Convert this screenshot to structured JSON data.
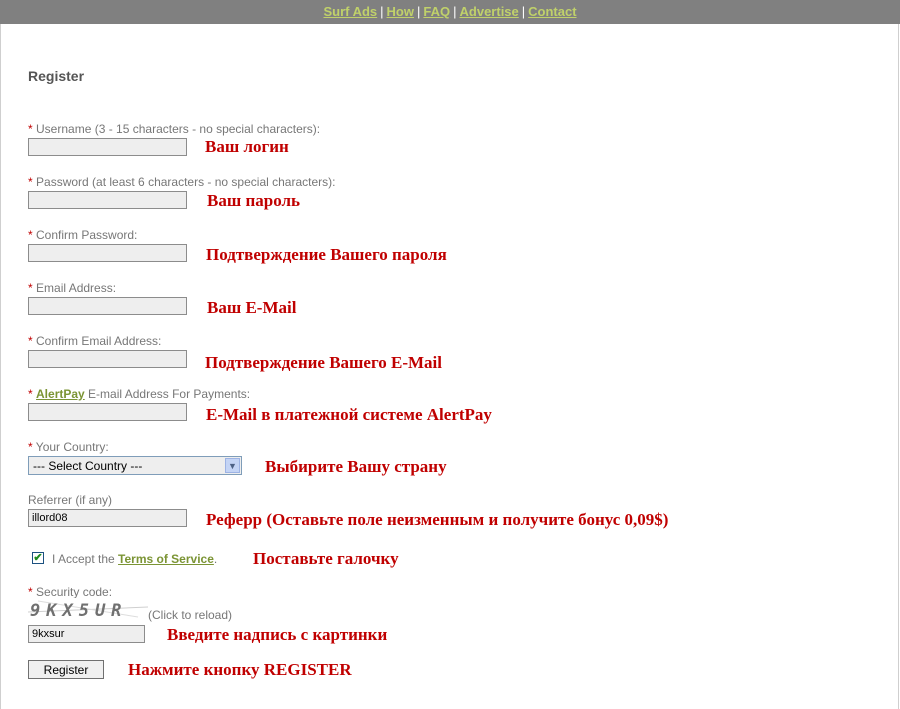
{
  "nav": [
    {
      "label": "Surf Ads"
    },
    {
      "label": "How"
    },
    {
      "label": "FAQ"
    },
    {
      "label": "Advertise"
    },
    {
      "label": "Contact"
    }
  ],
  "nav_separator": "|",
  "page_title": "Register",
  "required_marker": "*",
  "fields": {
    "username": {
      "label": "Username (3 - 15 characters - no special characters):",
      "value": "",
      "note": "Ваш логин"
    },
    "password": {
      "label": "Password (at least 6 characters - no special characters):",
      "value": "",
      "note": "Ваш пароль"
    },
    "confirm_password": {
      "label": "Confirm Password:",
      "value": "",
      "note": "Подтверждение Вашего пароля"
    },
    "email": {
      "label": "Email Address:",
      "value": "",
      "note": "Ваш E-Mail"
    },
    "confirm_email": {
      "label": "Confirm Email Address:",
      "value": "",
      "note": "Подтверждение Вашего E-Mail"
    },
    "alertpay": {
      "link": "AlertPay",
      "label": " E-mail Address For Payments:",
      "value": "",
      "note": "E-Mail в платежной системе AlertPay"
    },
    "country": {
      "label": "Your Country:",
      "selected": "--- Select Country ---",
      "note": "Выбирите Вашу страну"
    },
    "referrer": {
      "label": "Referrer (if any)",
      "value": "illord08",
      "note": "Реферр (Оставьте поле неизменным и получите бонус 0,09$)"
    },
    "terms": {
      "prefix": "I Accept the ",
      "link": "Terms of Service",
      "suffix": ".",
      "checked": true,
      "check_glyph": "✔",
      "note": "Поставьте галочку"
    },
    "security": {
      "label": "Security code:",
      "captcha_text": "9KX5UR",
      "reload": "(Click to reload)",
      "value": "9kxsur",
      "note": "Введите надпись с картинки"
    }
  },
  "submit": {
    "label": "Register",
    "note": "Нажмите  кнопку REGISTER"
  },
  "icons": {
    "dropdown": "chevron-down-icon",
    "check": "checkmark-icon"
  },
  "colors": {
    "nav_bg": "#808080",
    "nav_link": "#c0d16a",
    "required": "#c00000",
    "note_red": "#c00000",
    "link_green": "#7b9434"
  }
}
